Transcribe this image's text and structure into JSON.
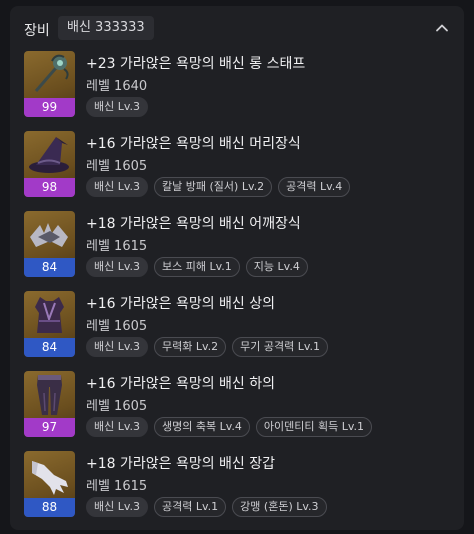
{
  "header": {
    "title": "장비",
    "set_badge": "배신 333333"
  },
  "items": [
    {
      "name": "+23 가라앉은 욕망의 배신 롱 스태프",
      "level": "레벨 1640",
      "item_level": "99",
      "grade_color": "#a23ac8",
      "icon": "staff-icon",
      "tags": [
        "배신 Lv.3"
      ]
    },
    {
      "name": "+16 가라앉은 욕망의 배신 머리장식",
      "level": "레벨 1605",
      "item_level": "98",
      "grade_color": "#a23ac8",
      "icon": "witch-hat-icon",
      "tags": [
        "배신 Lv.3",
        "칼날 방패 (질서) Lv.2",
        "공격력 Lv.4"
      ]
    },
    {
      "name": "+18 가라앉은 욕망의 배신 어깨장식",
      "level": "레벨 1615",
      "item_level": "84",
      "grade_color": "#2f58c4",
      "icon": "shoulder-guard-icon",
      "tags": [
        "배신 Lv.3",
        "보스 피해 Lv.1",
        "지능 Lv.4"
      ]
    },
    {
      "name": "+16 가라앉은 욕망의 배신 상의",
      "level": "레벨 1605",
      "item_level": "84",
      "grade_color": "#2f58c4",
      "icon": "chest-armor-icon",
      "tags": [
        "배신 Lv.3",
        "무력화 Lv.2",
        "무기 공격력 Lv.1"
      ]
    },
    {
      "name": "+16 가라앉은 욕망의 배신 하의",
      "level": "레벨 1605",
      "item_level": "97",
      "grade_color": "#a23ac8",
      "icon": "leg-armor-icon",
      "tags": [
        "배신 Lv.3",
        "생명의 축복 Lv.4",
        "아이덴티티 획득 Lv.1"
      ]
    },
    {
      "name": "+18 가라앉은 욕망의 배신 장갑",
      "level": "레벨 1615",
      "item_level": "88",
      "grade_color": "#2f58c4",
      "icon": "glove-icon",
      "tags": [
        "배신 Lv.3",
        "공격력 Lv.1",
        "강맹 (혼돈) Lv.3"
      ]
    }
  ]
}
